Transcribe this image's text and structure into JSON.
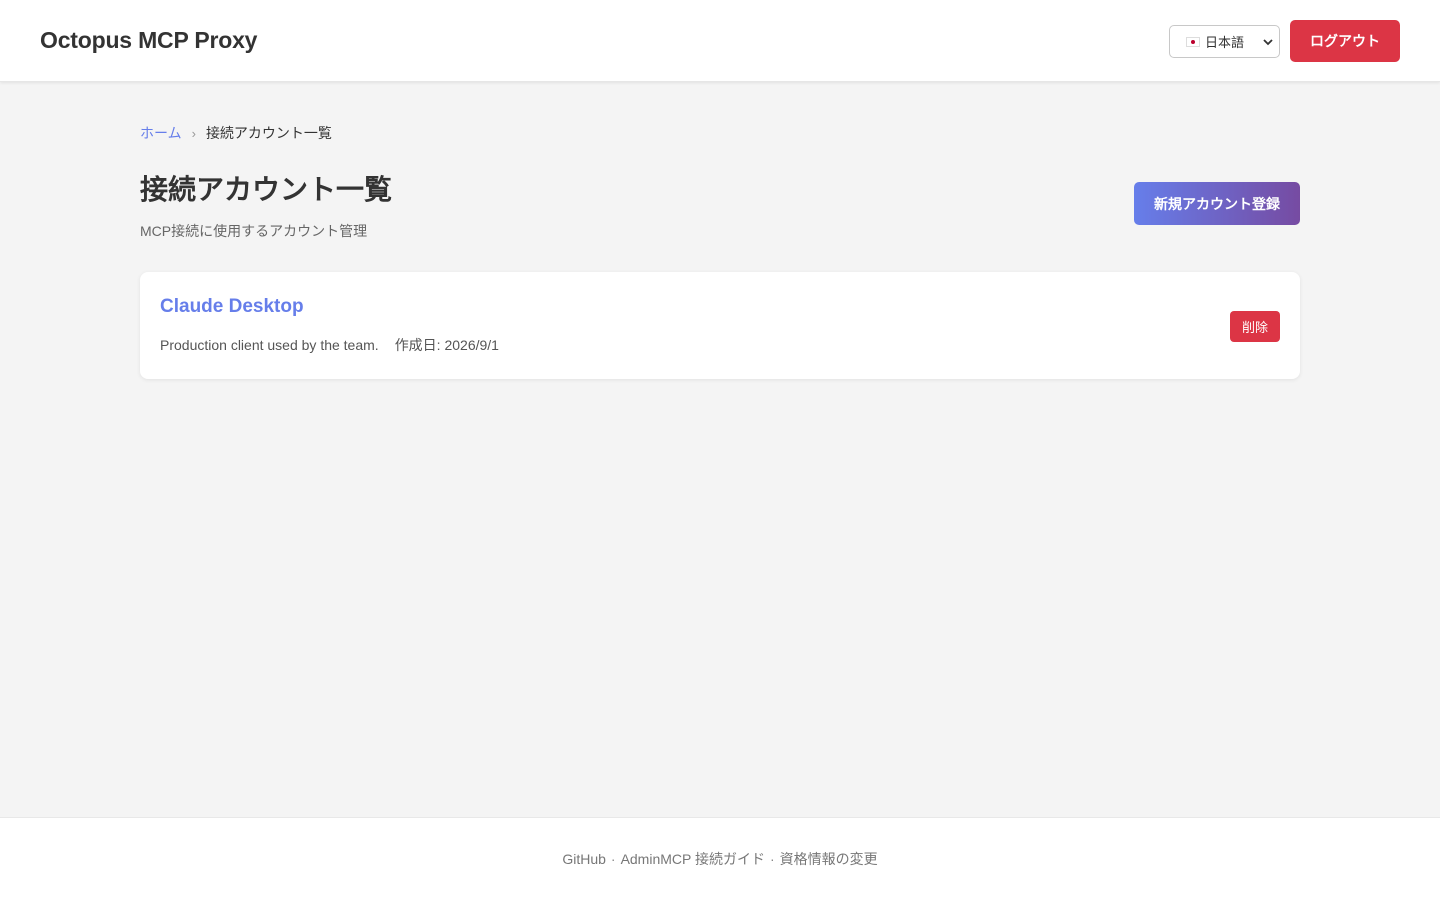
{
  "header": {
    "brand": "Octopus MCP Proxy",
    "language": {
      "selected": "日本語",
      "flag_icon": "japan-flag-icon"
    },
    "logout_label": "ログアウト"
  },
  "breadcrumb": {
    "home": "ホーム",
    "separator": "›",
    "current": "接続アカウント一覧"
  },
  "main": {
    "title": "接続アカウント一覧",
    "subtitle": "MCP接続に使用するアカウント管理",
    "new_account_label": "新規アカウント登録",
    "accounts": [
      {
        "name": "Claude Desktop",
        "description": "Production client used by the team.",
        "created": "作成日: 2026/9/1",
        "delete_label": "削除"
      }
    ]
  },
  "footer": {
    "github": "GitHub",
    "sep": "·",
    "guide": "AdminMCP 接続ガイド",
    "credentials": "資格情報の変更"
  },
  "colors": {
    "accent": "#667eea",
    "accent_end": "#764ba2",
    "danger": "#dc3545",
    "background": "#f4f4f4"
  }
}
